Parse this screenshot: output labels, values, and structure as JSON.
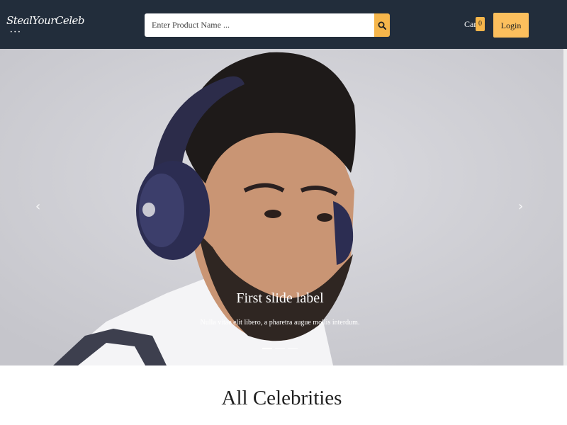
{
  "header": {
    "brand": "StealYourCeleb",
    "brand_dots": "•••",
    "search": {
      "placeholder": "Enter Product Name ...",
      "value": ""
    },
    "search_icon": "search-icon",
    "cart_label": "Cart",
    "cart_count": "0",
    "login_label": "Login"
  },
  "carousel": {
    "prev_icon": "chevron-left-icon",
    "next_icon": "chevron-right-icon",
    "prev_glyph": "‹",
    "next_glyph": "›",
    "slide": {
      "label": "First slide label",
      "text": "Nulla vitae elit libero, a pharetra augue mollis interdum."
    },
    "indicators": [
      {
        "active": true
      },
      {
        "active": false
      },
      {
        "active": false
      }
    ]
  },
  "main": {
    "section_title": "All Celebrities"
  },
  "colors": {
    "navbar": "#222d3b",
    "accent": "#fcbf5d"
  }
}
